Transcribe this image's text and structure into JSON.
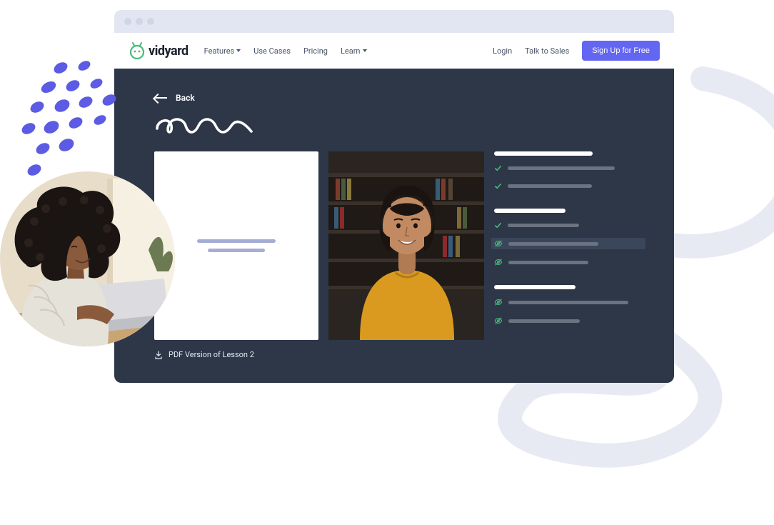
{
  "brand": {
    "name": "vidyard",
    "accent": "#48bb78",
    "primary": "#6366f1"
  },
  "nav": {
    "items": [
      {
        "label": "Features",
        "has_dropdown": true
      },
      {
        "label": "Use Cases",
        "has_dropdown": false
      },
      {
        "label": "Pricing",
        "has_dropdown": false
      },
      {
        "label": "Learn",
        "has_dropdown": true
      }
    ],
    "login": "Login",
    "talk_to_sales": "Talk to Sales",
    "signup": "Sign Up for Free"
  },
  "lesson": {
    "back_label": "Back",
    "pdf_label": "PDF Version of Lesson 2",
    "playlist": [
      {
        "type": "heading",
        "width": 138
      },
      {
        "type": "item",
        "icon": "check",
        "width": 150
      },
      {
        "type": "item",
        "icon": "check",
        "width": 118
      },
      {
        "type": "divider"
      },
      {
        "type": "heading",
        "width": 100
      },
      {
        "type": "item",
        "icon": "check",
        "width": 100
      },
      {
        "type": "item",
        "icon": "eye",
        "width": 126,
        "selected": true
      },
      {
        "type": "item",
        "icon": "eye",
        "width": 112
      },
      {
        "type": "divider"
      },
      {
        "type": "heading",
        "width": 114
      },
      {
        "type": "item",
        "icon": "eye",
        "width": 168
      },
      {
        "type": "item",
        "icon": "eye",
        "width": 100
      }
    ]
  }
}
